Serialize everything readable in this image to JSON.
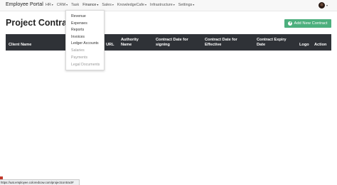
{
  "navbar": {
    "brand": "Employee Portal",
    "items": [
      {
        "label": "HR",
        "caret": "▾"
      },
      {
        "label": "CRM",
        "caret": "▾"
      },
      {
        "label": "Task",
        "caret": ""
      },
      {
        "label": "Finance",
        "caret": "▾"
      },
      {
        "label": "Sales",
        "caret": "▾"
      },
      {
        "label": "KnowledgeCafe",
        "caret": "▾"
      },
      {
        "label": "Infrastructure",
        "caret": "▾"
      },
      {
        "label": "Settings",
        "caret": "▾"
      }
    ],
    "user_caret": "▾"
  },
  "page": {
    "title": "Project Contract",
    "add_button": "Add New Contract",
    "add_icon": "+"
  },
  "table": {
    "headers": {
      "client_name": "Client Name",
      "url": "URL",
      "authority_name": "Authority Name",
      "signing": "Contract Date for signing",
      "effective": "Contract Date for Effective",
      "expiry": "Contract Expiry Date",
      "logo": "Logo",
      "action": "Action"
    }
  },
  "finance_menu": {
    "items": [
      {
        "label": "Revenue",
        "enabled": true
      },
      {
        "label": "Expenses",
        "enabled": true
      },
      {
        "label": "Reports",
        "enabled": true
      },
      {
        "label": "Invoices",
        "enabled": true
      },
      {
        "label": "Ledger Accounts",
        "enabled": true
      },
      {
        "label": "Salaries",
        "enabled": false
      },
      {
        "label": "Payments",
        "enabled": false
      },
      {
        "label": "Legal Documents",
        "enabled": false
      }
    ]
  },
  "statusbar": {
    "url": "https://uat.employee.coloredcow.com/projectcontract#"
  },
  "colors": {
    "accent_green": "#4caf7d",
    "table_header": "#2f3237"
  }
}
